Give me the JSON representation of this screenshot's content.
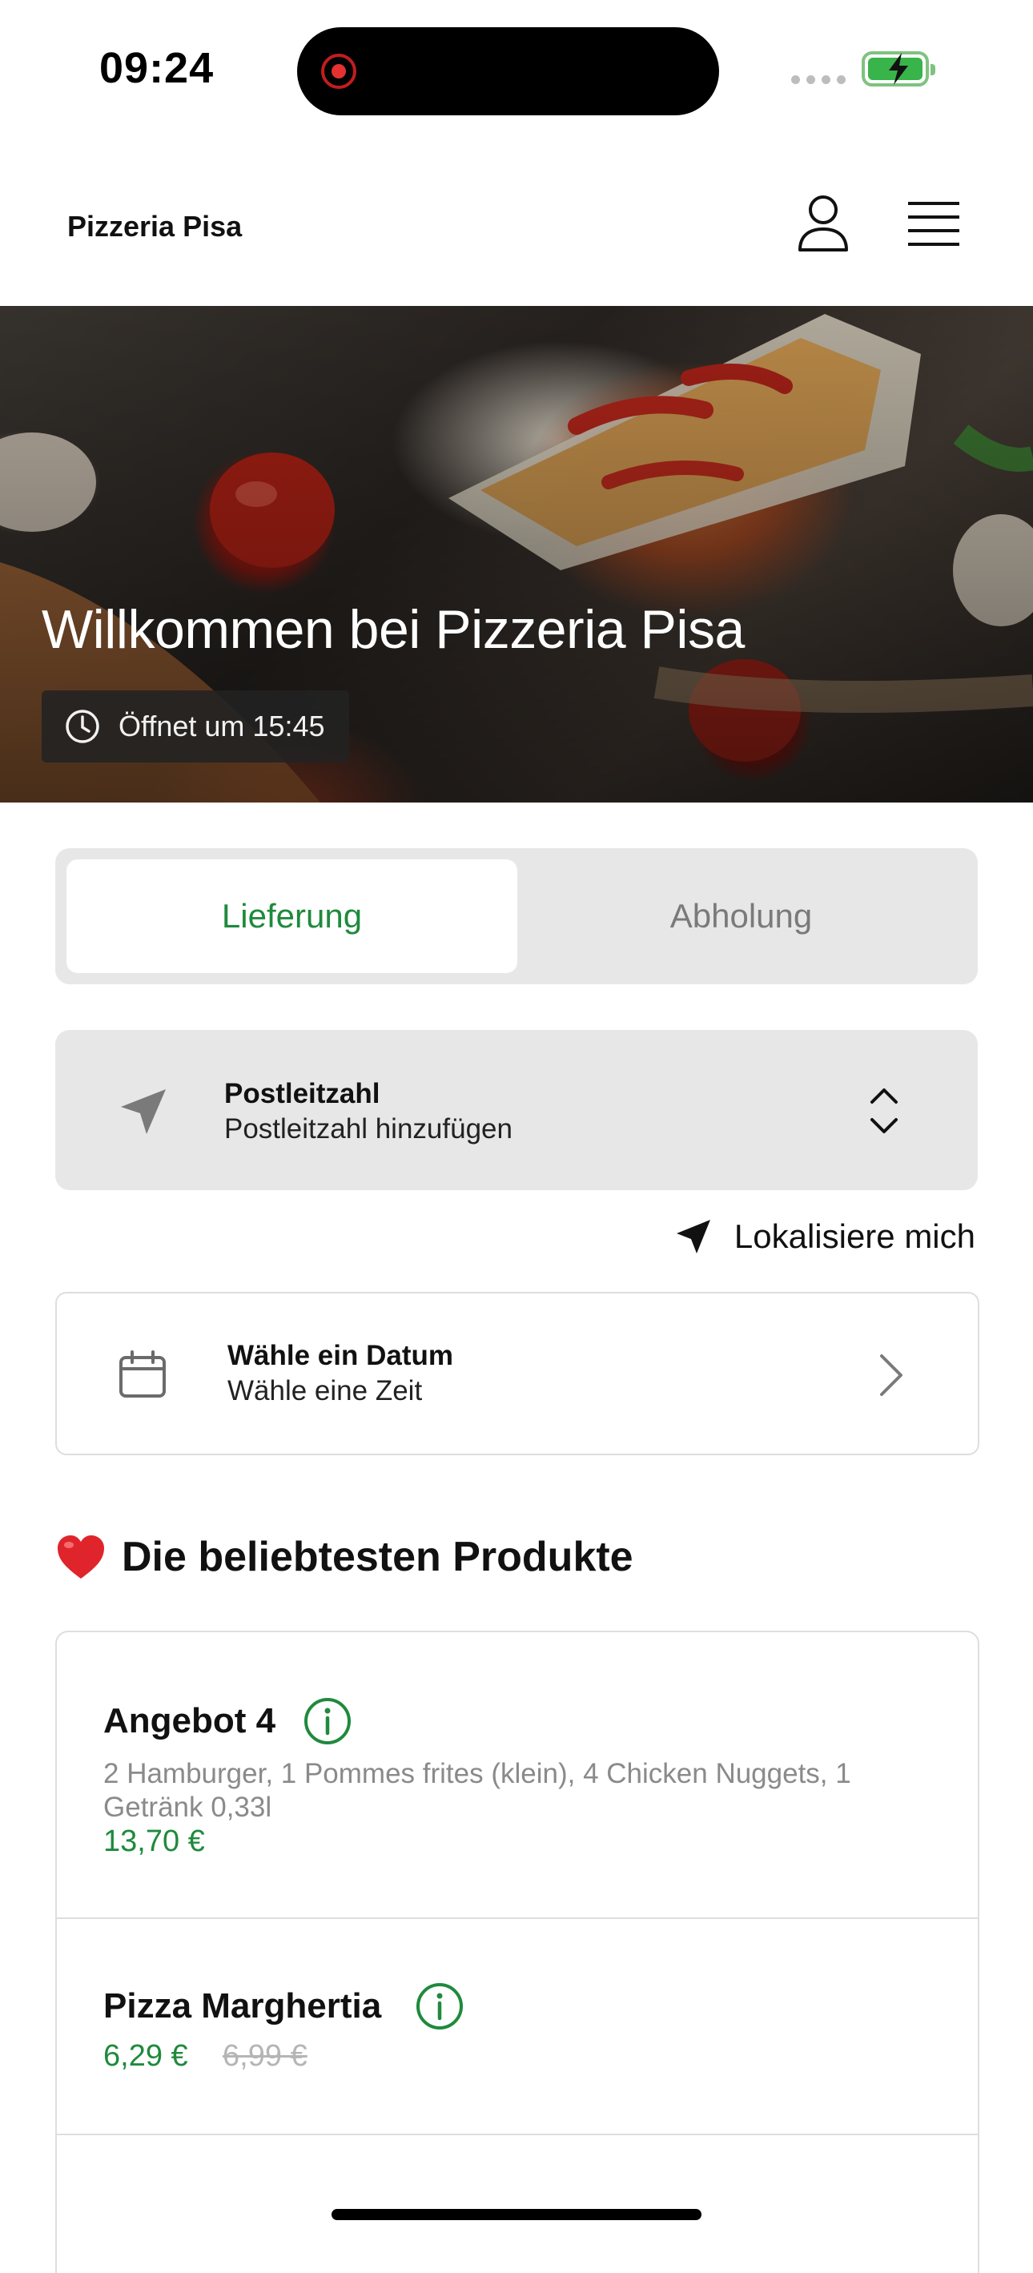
{
  "status_bar": {
    "time": "09:24",
    "colors": {
      "recording": "#e53131",
      "battery": "#38b44a"
    }
  },
  "header": {
    "brand": "Pizzeria Pisa",
    "icons": [
      "user-icon",
      "hamburger-menu-icon"
    ]
  },
  "hero": {
    "title": "Willkommen bei Pizzeria Pisa",
    "hours_text": "Öffnet um 15:45",
    "hours_icon": "clock-icon"
  },
  "order_mode": {
    "options": [
      {
        "label": "Lieferung",
        "selected": true
      },
      {
        "label": "Abholung",
        "selected": false
      }
    ]
  },
  "postcode": {
    "label": "Postleitzahl",
    "placeholder": "Postleitzahl hinzufügen",
    "icon": "location-arrow-icon"
  },
  "locate": {
    "label": "Lokalisiere mich",
    "icon": "navigation-arrow-icon"
  },
  "datetime": {
    "title": "Wähle ein Datum",
    "subtitle": "Wähle eine Zeit",
    "icon": "calendar-icon"
  },
  "popular": {
    "title": "Die beliebtesten Produkte",
    "icon": "heart-icon",
    "products": [
      {
        "name": "Angebot 4",
        "description": "2 Hamburger, 1 Pommes frites (klein), 4 Chicken Nuggets, 1 Getränk 0,33l",
        "price": "13,70 €"
      },
      {
        "name": "Pizza Marghertia",
        "price": "6,29 €",
        "old_price": "6,99 €"
      }
    ]
  },
  "colors": {
    "accent_green": "#1f8a3c",
    "surface_grey": "#e7e7e7",
    "muted_text": "#8a8a8a"
  }
}
